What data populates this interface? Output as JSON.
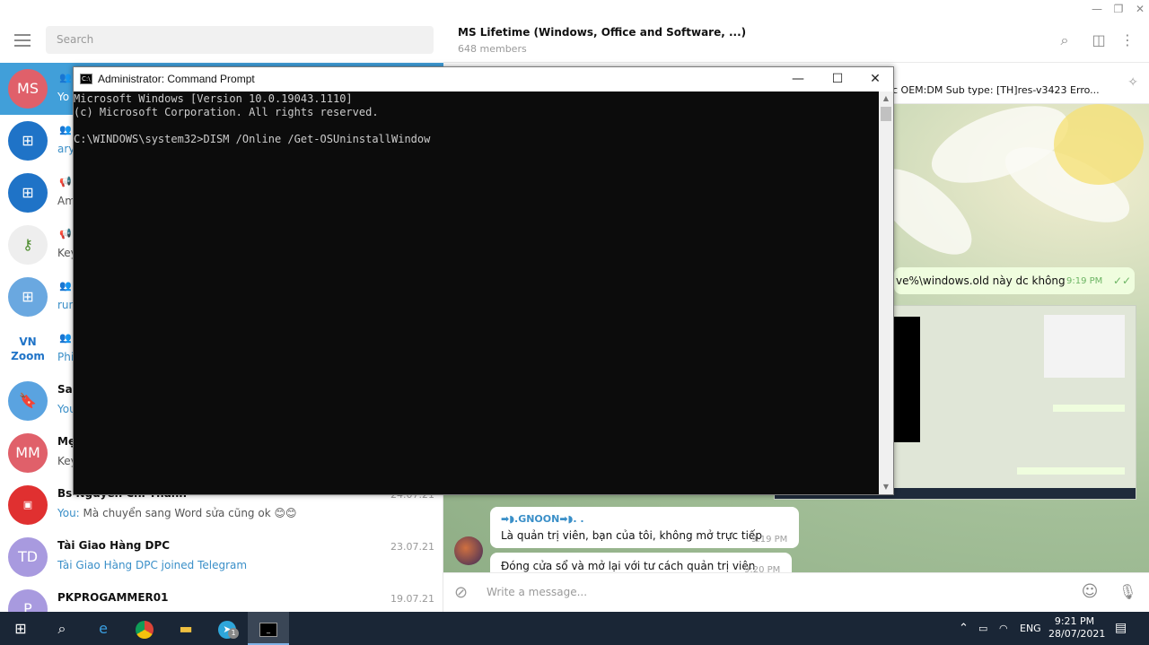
{
  "sidebar": {
    "search_placeholder": "Search",
    "chats": [
      {
        "avatar": "MS",
        "avatar_color": "#e0606a",
        "type_icon": "group-icon",
        "name": "",
        "date": "",
        "msg_prefix": "",
        "msg": "Yo"
      },
      {
        "avatar": "",
        "avatar_color": "#1f73c7",
        "type_icon": "group-icon",
        "name": "",
        "date": "",
        "msg_prefix": "",
        "msg": "ary"
      },
      {
        "avatar": "",
        "avatar_color": "#1f73c7",
        "type_icon": "megaphone-icon",
        "name": "",
        "date": "",
        "msg_prefix": "",
        "msg": "Am"
      },
      {
        "avatar": "",
        "avatar_color": "#eeeeee",
        "type_icon": "megaphone-icon",
        "name": "",
        "date": "",
        "msg_prefix": "",
        "msg": "Key"
      },
      {
        "avatar": "",
        "avatar_color": "#6aa8e0",
        "type_icon": "group-icon",
        "name": "",
        "date": "",
        "msg_prefix": "",
        "msg": "run"
      },
      {
        "avatar": "VN Zoom",
        "avatar_color": "#ffffff",
        "type_icon": "group-icon",
        "name": "",
        "date": "",
        "msg_prefix": "",
        "msg": "Phi"
      },
      {
        "avatar": "",
        "avatar_color": "#5aa3e0",
        "type_icon": "",
        "name": "Sav",
        "date": "",
        "msg_prefix": "",
        "msg": "You"
      },
      {
        "avatar": "MM",
        "avatar_color": "#e0606a",
        "type_icon": "",
        "name": "Mẹ",
        "date": "",
        "msg_prefix": "",
        "msg": "Key"
      },
      {
        "avatar": "",
        "avatar_color": "#e03030",
        "type_icon": "",
        "name": "Bs Nguyễn Chí Thành",
        "date": "24.07.21",
        "msg_prefix": "You:",
        "msg": " Mà chuyển sang Word sửa cũng ok 😊😊"
      },
      {
        "avatar": "TD",
        "avatar_color": "#a89adf",
        "type_icon": "",
        "name": "Tài Giao Hàng DPC",
        "date": "23.07.21",
        "msg_prefix": "",
        "msg": "Tài Giao Hàng DPC joined Telegram"
      },
      {
        "avatar": "P",
        "avatar_color": "#a89adf",
        "type_icon": "",
        "name": "PKPROGAMMER01",
        "date": "19.07.21",
        "msg_prefix": "",
        "msg": ""
      }
    ]
  },
  "group": {
    "title": "MS Lifetime (Windows, Office and Software, ...)",
    "members": "648 members",
    "pinned_text": "c OEM:DM Sub type: [TH]res-v3423 Erro..."
  },
  "messages": {
    "own_fragment": "ve%\\windows.old  này dc không",
    "own_time": "9:19 PM",
    "sender": "➡◗.GNOON➡◗. .",
    "msg1": "Là quản trị viên, bạn của tôi, không mở trực tiếp",
    "msg1_time": "9:19 PM",
    "msg2": "Đóng cửa sổ và mở lại với tư cách quản trị viên",
    "msg2_time": "9:20 PM"
  },
  "composer": {
    "placeholder": "Write a message..."
  },
  "cmd": {
    "title": "Administrator: Command Prompt",
    "lines": [
      "Microsoft Windows [Version 10.0.19043.1110]",
      "(c) Microsoft Corporation. All rights reserved.",
      "",
      "C:\\WINDOWS\\system32>DISM /Online /Get-OSUninstallWindow"
    ]
  },
  "taskbar": {
    "lang": "ENG",
    "time": "9:21 PM",
    "date": "28/07/2021",
    "telegram_badge": "1"
  }
}
